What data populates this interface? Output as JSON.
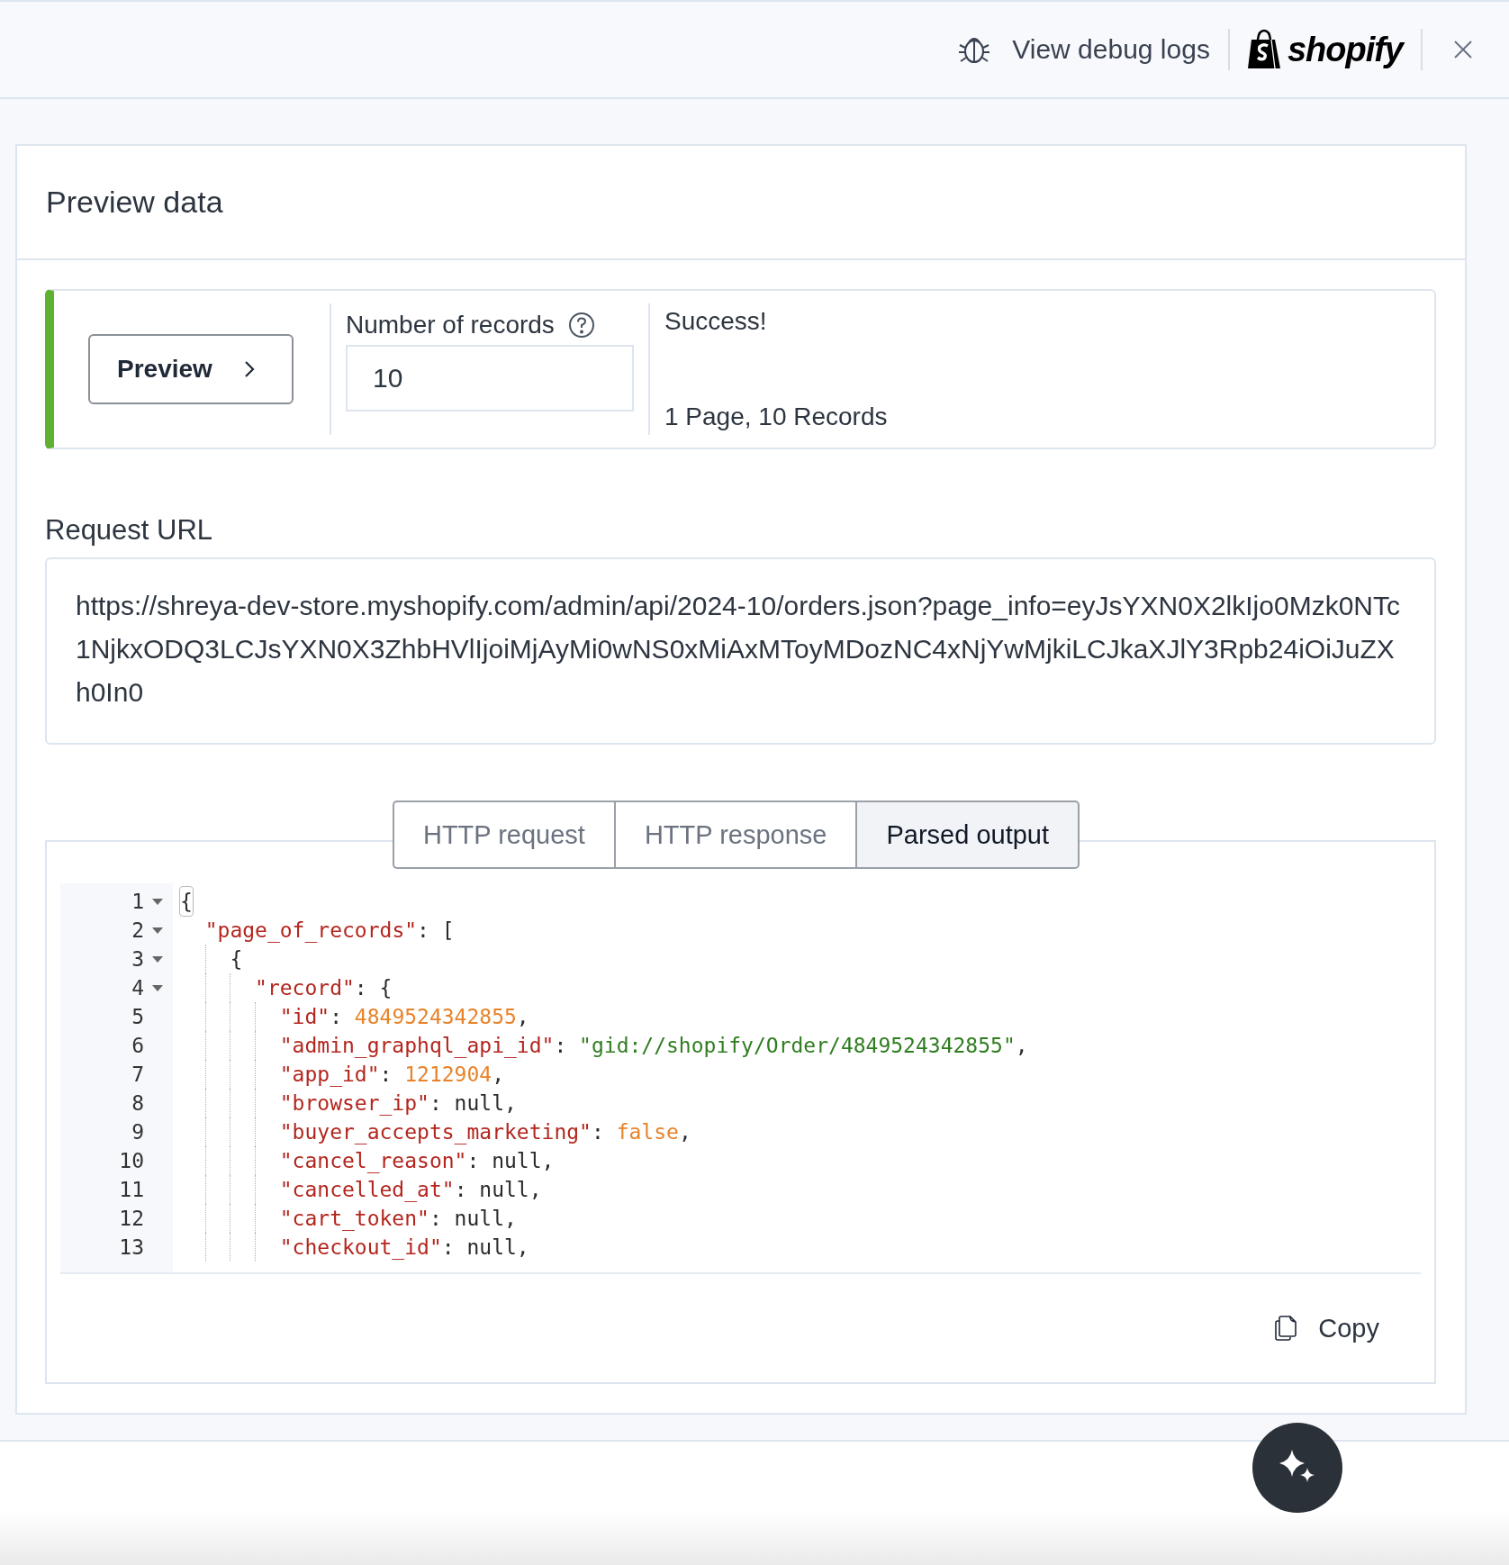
{
  "top_bar": {
    "debug_link": "View debug logs",
    "logo_text": "shopify"
  },
  "card": {
    "title": "Preview data",
    "preview": {
      "succeeded": true,
      "button": "Preview",
      "records_label": "Number of records",
      "records_value": "10",
      "result_title": "Success!",
      "result_summary": "1 Page, 10 Records"
    },
    "request_url": {
      "label": "Request URL",
      "value": "https://shreya-dev-store.myshopify.com/admin/api/2024-10/orders.json?page_info=eyJsYXN0X2lkIjo0Mzk0NTc1NjkxODQ3LCJsYXN0X3ZhbHVlIjoiMjAyMi0wNS0xMiAxMToyMDozNC4xNjYwMjkiLCJkaXJlY3Rpb24iOiJuZXh0In0"
    },
    "tabs": [
      {
        "label": "HTTP request",
        "selected": false
      },
      {
        "label": "HTTP response",
        "selected": false
      },
      {
        "label": "Parsed output",
        "selected": true
      }
    ],
    "code": [
      {
        "number": "1",
        "expanded": true,
        "tokens": [
          {
            "kind": "punct",
            "text": "{",
            "highlighted": true
          }
        ],
        "children": [
          {
            "number": "2",
            "expanded": true,
            "tokens": [
              {
                "kind": "key",
                "text": "\"page_of_records\""
              },
              {
                "kind": "punct",
                "text": ": ["
              }
            ],
            "children": [
              {
                "number": "3",
                "expanded": true,
                "tokens": [
                  {
                    "kind": "punct",
                    "text": "{"
                  }
                ],
                "children": [
                  {
                    "number": "4",
                    "expanded": true,
                    "tokens": [
                      {
                        "kind": "key",
                        "text": "\"record\""
                      },
                      {
                        "kind": "punct",
                        "text": ": {"
                      }
                    ],
                    "children": [
                      {
                        "number": "5",
                        "tokens": [
                          {
                            "kind": "key",
                            "text": "\"id\""
                          },
                          {
                            "kind": "punct",
                            "text": ": "
                          },
                          {
                            "kind": "number",
                            "text": "4849524342855"
                          },
                          {
                            "kind": "punct",
                            "text": ","
                          }
                        ]
                      },
                      {
                        "number": "6",
                        "tokens": [
                          {
                            "kind": "key",
                            "text": "\"admin_graphql_api_id\""
                          },
                          {
                            "kind": "punct",
                            "text": ": "
                          },
                          {
                            "kind": "string",
                            "text": "\"gid://shopify/Order/4849524342855\""
                          },
                          {
                            "kind": "punct",
                            "text": ","
                          }
                        ]
                      },
                      {
                        "number": "7",
                        "tokens": [
                          {
                            "kind": "key",
                            "text": "\"app_id\""
                          },
                          {
                            "kind": "punct",
                            "text": ": "
                          },
                          {
                            "kind": "number",
                            "text": "1212904"
                          },
                          {
                            "kind": "punct",
                            "text": ","
                          }
                        ]
                      },
                      {
                        "number": "8",
                        "tokens": [
                          {
                            "kind": "key",
                            "text": "\"browser_ip\""
                          },
                          {
                            "kind": "punct",
                            "text": ": null,"
                          }
                        ]
                      },
                      {
                        "number": "9",
                        "tokens": [
                          {
                            "kind": "key",
                            "text": "\"buyer_accepts_marketing\""
                          },
                          {
                            "kind": "punct",
                            "text": ": "
                          },
                          {
                            "kind": "boolean",
                            "text": "false"
                          },
                          {
                            "kind": "punct",
                            "text": ","
                          }
                        ]
                      },
                      {
                        "number": "10",
                        "tokens": [
                          {
                            "kind": "key",
                            "text": "\"cancel_reason\""
                          },
                          {
                            "kind": "punct",
                            "text": ": null,"
                          }
                        ]
                      },
                      {
                        "number": "11",
                        "tokens": [
                          {
                            "kind": "key",
                            "text": "\"cancelled_at\""
                          },
                          {
                            "kind": "punct",
                            "text": ": null,"
                          }
                        ]
                      },
                      {
                        "number": "12",
                        "tokens": [
                          {
                            "kind": "key",
                            "text": "\"cart_token\""
                          },
                          {
                            "kind": "punct",
                            "text": ": null,"
                          }
                        ]
                      },
                      {
                        "number": "13",
                        "tokens": [
                          {
                            "kind": "key",
                            "text": "\"checkout_id\""
                          },
                          {
                            "kind": "punct",
                            "text": ": null,"
                          }
                        ]
                      }
                    ]
                  }
                ]
              }
            ]
          }
        ]
      }
    ],
    "copy_button": "Copy"
  }
}
